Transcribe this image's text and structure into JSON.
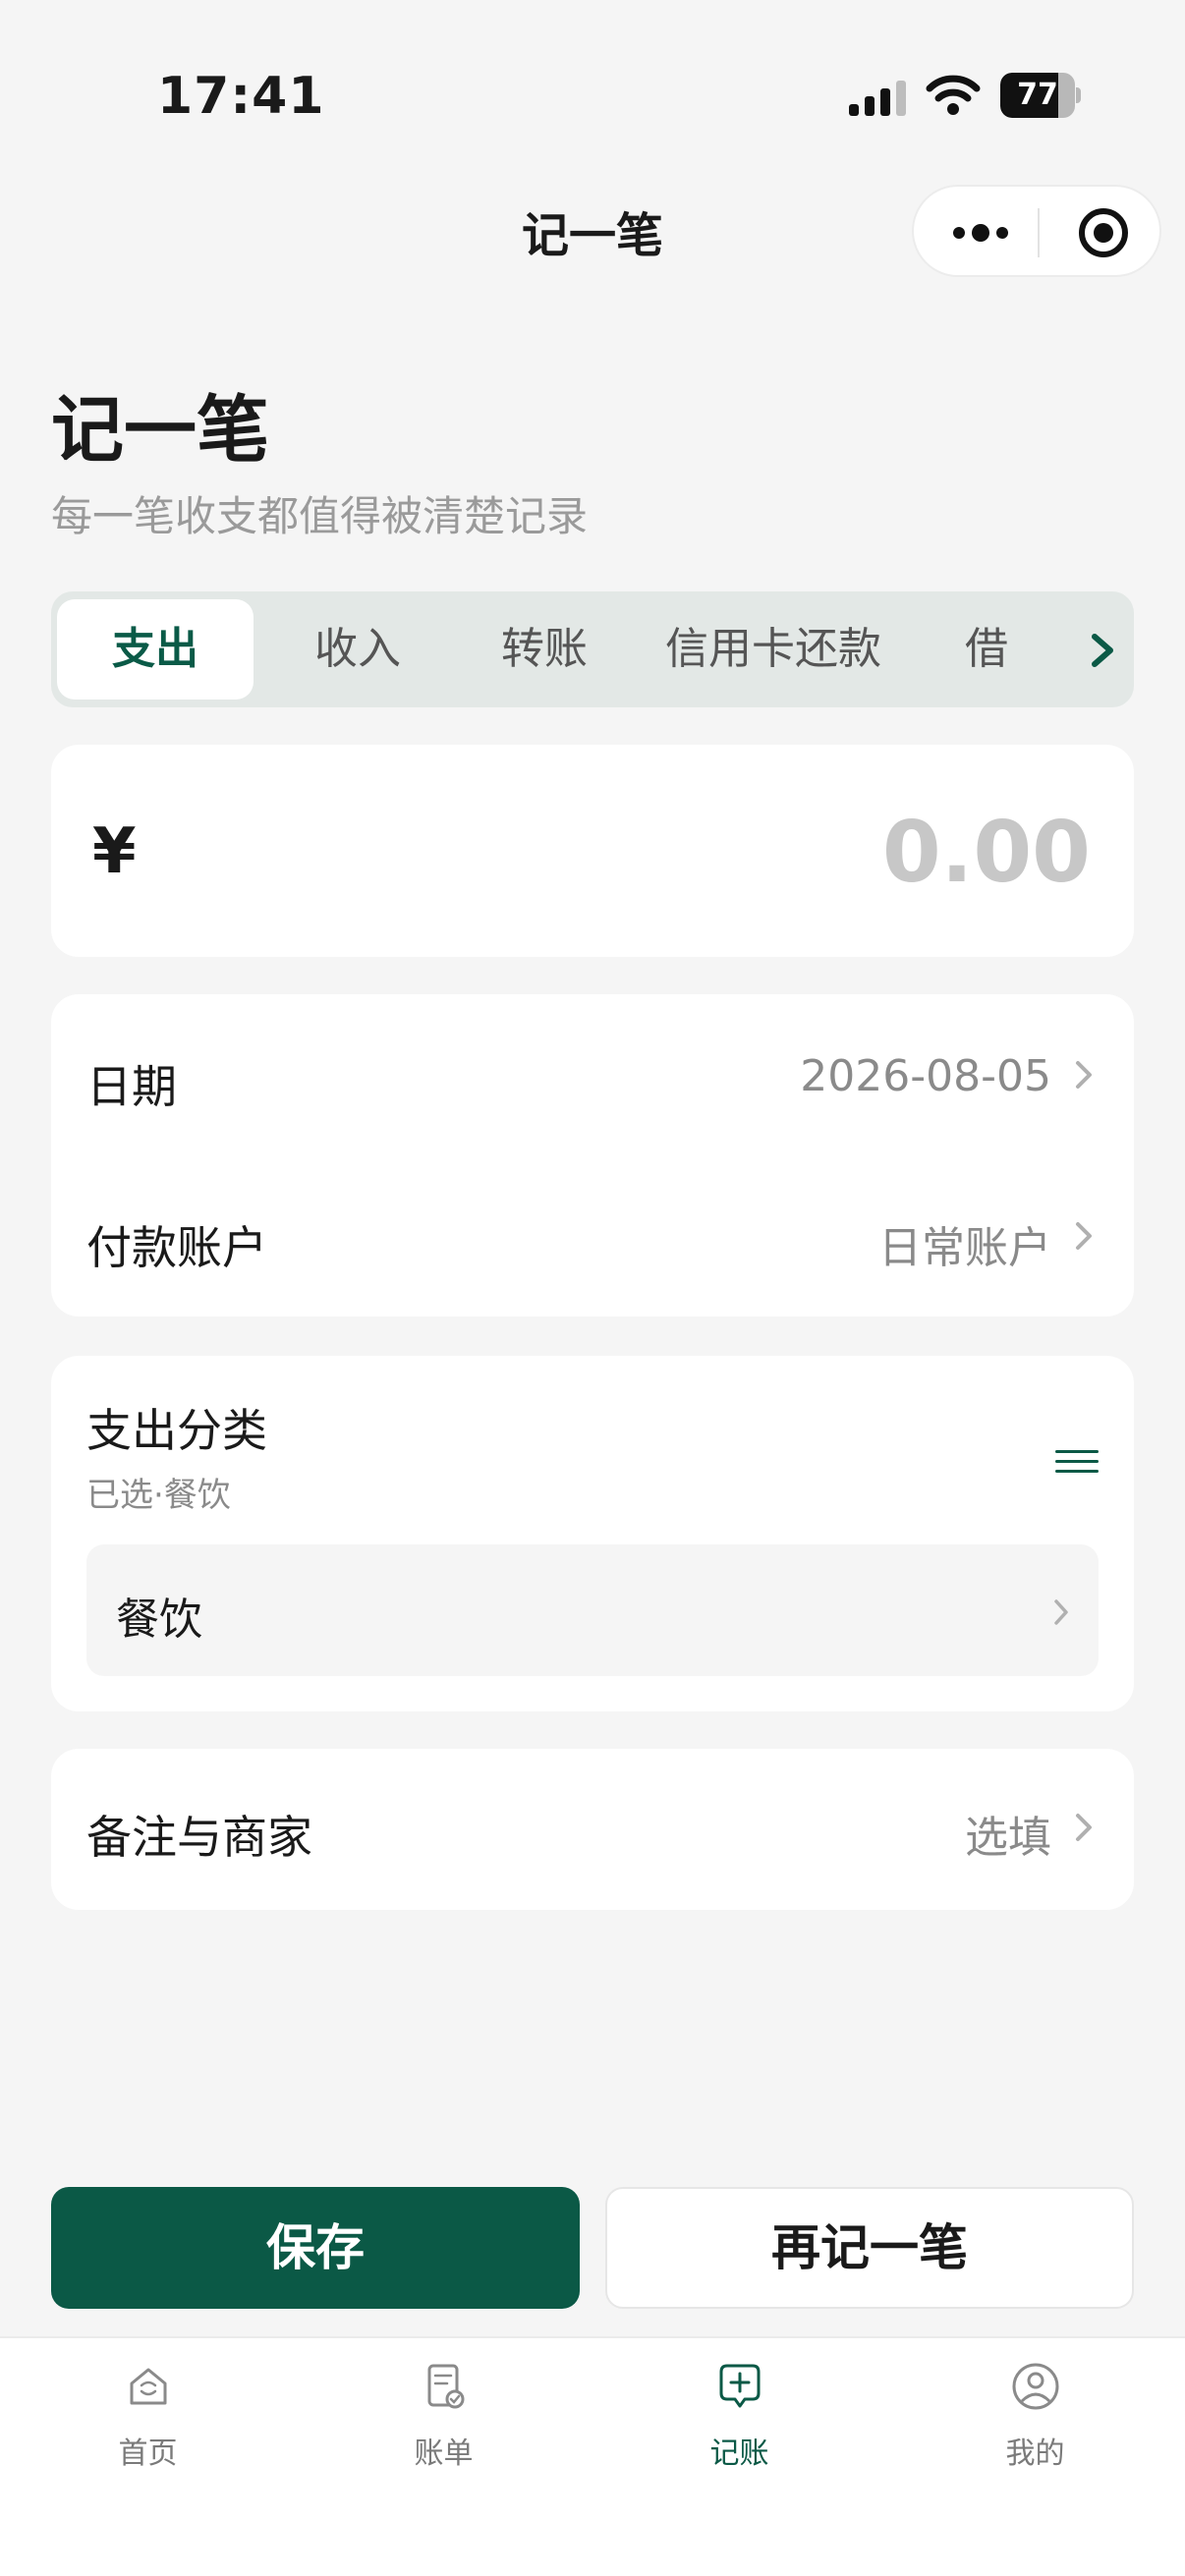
{
  "status_bar": {
    "time": "17:41",
    "battery": "77",
    "battery_level": 0.77
  },
  "nav": {
    "title": "记一笔"
  },
  "header": {
    "title": "记一笔",
    "subtitle": "每一笔收支都值得被清楚记录"
  },
  "tabs": [
    {
      "label": "支出",
      "active": true
    },
    {
      "label": "收入",
      "active": false
    },
    {
      "label": "转账",
      "active": false
    },
    {
      "label": "信用卡还款",
      "active": false
    },
    {
      "label": "借",
      "active": false
    }
  ],
  "amount": {
    "currency": "¥",
    "value": "0.00"
  },
  "fields": {
    "date": {
      "label": "日期",
      "value": "2026-08-05"
    },
    "account": {
      "label": "付款账户",
      "value": "日常账户"
    }
  },
  "category": {
    "title": "支出分类",
    "selected_text": "已选·餐饮",
    "value": "餐饮"
  },
  "note": {
    "label": "备注与商家",
    "placeholder": "选填"
  },
  "actions": {
    "save": "保存",
    "again": "再记一笔"
  },
  "tabbar": [
    {
      "label": "首页",
      "icon": "home-icon",
      "active": false
    },
    {
      "label": "账单",
      "icon": "bill-icon",
      "active": false
    },
    {
      "label": "记账",
      "icon": "add-record-icon",
      "active": true
    },
    {
      "label": "我的",
      "icon": "profile-icon",
      "active": false
    }
  ],
  "colors": {
    "accent": "#0b5946",
    "background": "#f5f5f5",
    "tab_bg": "#e3e8e6"
  }
}
